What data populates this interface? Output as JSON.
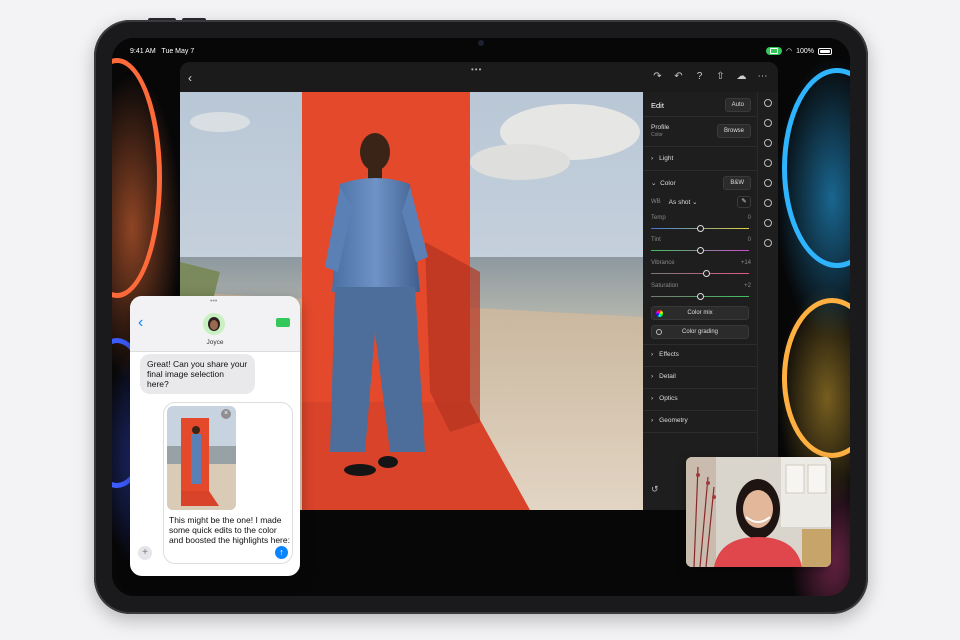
{
  "status_bar": {
    "time": "9:41 AM",
    "date": "Tue May 7",
    "battery": "100%",
    "handle_dots": "•••"
  },
  "lightroom": {
    "toolbar": {
      "back": "‹",
      "icons": [
        "redo-icon",
        "undo-icon",
        "help-icon",
        "share-icon",
        "cloud-sync-icon",
        "more-icon"
      ]
    },
    "panel": {
      "title": "Edit",
      "auto_label": "Auto",
      "profile_label": "Profile",
      "profile_value": "Color",
      "browse_label": "Browse",
      "light_label": "Light",
      "color_label": "Color",
      "bw_label": "B&W",
      "wb_label": "WB",
      "wb_value": "As shot",
      "sliders": [
        {
          "label": "Temp",
          "value": "0",
          "position": 0.5
        },
        {
          "label": "Tint",
          "value": "0",
          "position": 0.5
        },
        {
          "label": "Vibrance",
          "value": "+14",
          "position": 0.57
        },
        {
          "label": "Saturation",
          "value": "+2",
          "position": 0.51
        }
      ],
      "color_mix_label": "Color mix",
      "color_grading_label": "Color grading",
      "sections": [
        "Effects",
        "Detail",
        "Optics",
        "Geometry"
      ]
    }
  },
  "messages": {
    "contact": "Joyce",
    "incoming_text": "Great! Can you share your final image selection here?",
    "draft_text": "This might be the one! I made some quick edits to the color and boosted the highlights here:"
  },
  "colors": {
    "accent_blue": "#0a84ff",
    "facetime_green": "#34c759",
    "red_backdrop": "#e8482b"
  }
}
